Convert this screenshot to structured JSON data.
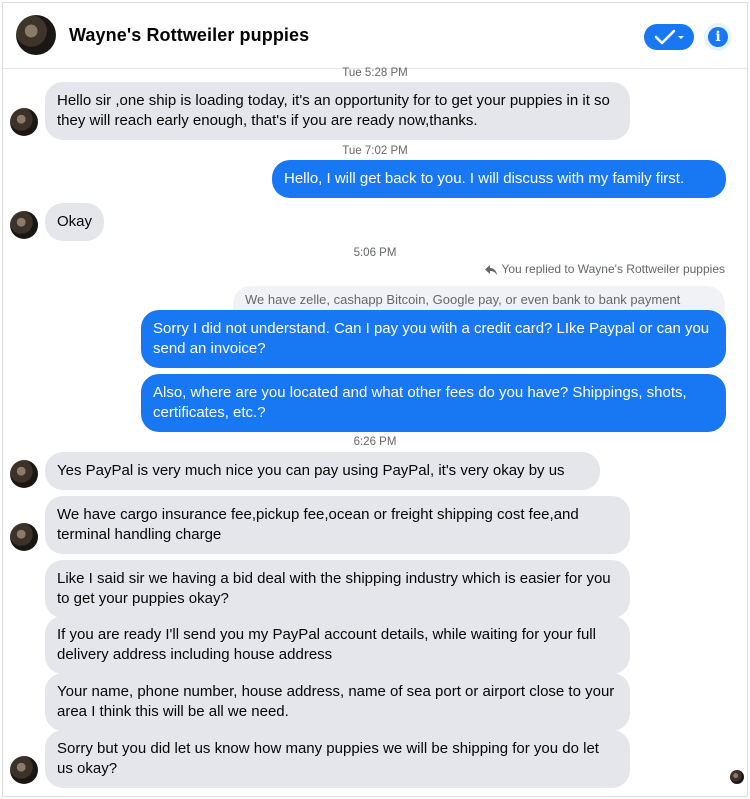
{
  "header": {
    "title": "Wayne's Rottweiler puppies",
    "avatar_icon": "contact-avatar",
    "check_icon": "checkmark-dropdown-icon",
    "info_icon": "info-icon",
    "accent": "#1877f2"
  },
  "timestamps": [
    "Tue 5:28 PM",
    "Tue 7:02 PM",
    "5:06 PM",
    "6:26 PM"
  ],
  "reply": {
    "note": "You replied to Wayne's Rottweiler puppies",
    "quoted": "We have zelle, cashapp Bitcoin, Google pay, or even bank to bank payment"
  },
  "messages": [
    {
      "from": "them",
      "text": "Hello sir ,one ship is loading today, it's an opportunity for to get your puppies in it so they will reach early enough, that's if you are ready now,thanks."
    },
    {
      "from": "me",
      "text": "Hello, I will get back to you. I will discuss with my family first."
    },
    {
      "from": "them",
      "text": "Okay"
    },
    {
      "from": "me",
      "text": "Sorry I did not understand. Can I pay you with a credit card? LIke Paypal or can you send an invoice?"
    },
    {
      "from": "me",
      "text": "Also, where are you located and what other fees do you have? Shippings, shots, certificates, etc.?"
    },
    {
      "from": "them",
      "text": "Yes PayPal is very much nice you can pay using PayPal, it's very okay by us"
    },
    {
      "from": "them",
      "text": "We have cargo insurance fee,pickup fee,ocean or freight shipping cost fee,and terminal handling charge"
    },
    {
      "from": "them",
      "text": "Like I said sir we having a bid deal with the shipping industry which is easier for you to get your puppies okay?"
    },
    {
      "from": "them",
      "text": "If you are ready I'll send you my PayPal account details, while waiting for your full delivery address including house address"
    },
    {
      "from": "them",
      "text": "Your name, phone number, house address, name of sea port or airport close to your area I think this will be all we need."
    },
    {
      "from": "them",
      "text": "Sorry but you did let us know how many puppies we will be shipping for you do let us okay?"
    }
  ]
}
